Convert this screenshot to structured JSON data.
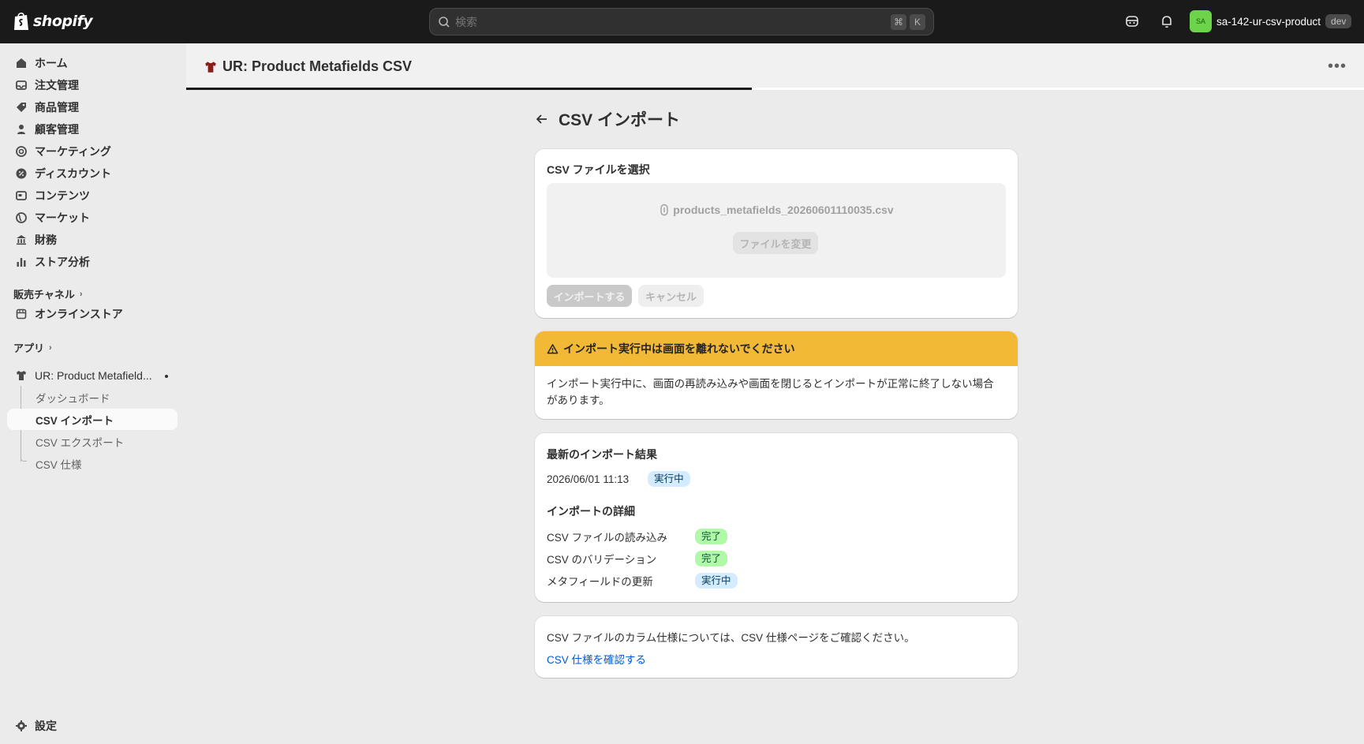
{
  "topbar": {
    "logo_text": "shopify",
    "search_placeholder": "検索",
    "shortcut_keys": [
      "⌘",
      "K"
    ],
    "store_avatar": "SA",
    "store_name": "sa-142-ur-csv-product",
    "store_badge": "dev"
  },
  "sidebar": {
    "items": [
      {
        "label": "ホーム",
        "icon": "home-icon"
      },
      {
        "label": "注文管理",
        "icon": "inbox-icon"
      },
      {
        "label": "商品管理",
        "icon": "tag-icon"
      },
      {
        "label": "顧客管理",
        "icon": "person-icon"
      },
      {
        "label": "マーケティング",
        "icon": "target-icon"
      },
      {
        "label": "ディスカウント",
        "icon": "discount-icon"
      },
      {
        "label": "コンテンツ",
        "icon": "content-icon"
      },
      {
        "label": "マーケット",
        "icon": "globe-icon"
      },
      {
        "label": "財務",
        "icon": "bank-icon"
      },
      {
        "label": "ストア分析",
        "icon": "chart-icon"
      }
    ],
    "sales_channels_label": "販売チャネル",
    "online_store_label": "オンラインストア",
    "apps_label": "アプリ",
    "app_name": "UR: Product Metafield...",
    "app_subitems": [
      "ダッシュボード",
      "CSV インポート",
      "CSV エクスポート",
      "CSV 仕様"
    ],
    "active_subitem": "CSV インポート",
    "settings_label": "設定"
  },
  "app_header": {
    "title": "UR: Product Metafields CSV",
    "loading_progress": 0.48
  },
  "page": {
    "title": "CSV インポート"
  },
  "file_card": {
    "title": "CSV ファイルを選択",
    "filename": "products_metafields_20260601110035.csv",
    "change_label": "ファイルを変更",
    "import_label": "インポートする",
    "cancel_label": "キャンセル"
  },
  "warning_card": {
    "title": "インポート実行中は画面を離れないでください",
    "body": "インポート実行中に、画面の再読み込みや画面を閉じるとインポートが正常に終了しない場合があります。"
  },
  "result_card": {
    "title": "最新のインポート結果",
    "timestamp": "2026/06/01 11:13",
    "status": "実行中",
    "details_title": "インポートの詳細",
    "steps": [
      {
        "label": "CSV ファイルの読み込み",
        "status": "完了"
      },
      {
        "label": "CSV のバリデーション",
        "status": "完了"
      },
      {
        "label": "メタフィールドの更新",
        "status": "実行中"
      }
    ]
  },
  "spec_card": {
    "text": "CSV ファイルのカラム仕様については、CSV 仕様ページをご確認ください。",
    "link": "CSV 仕様を確認する"
  },
  "colors": {
    "topbar": "#1a1a1a",
    "warning": "#f1b935",
    "link": "#005bd3",
    "badge_running": "#d5ebff",
    "badge_done": "#aff9a8",
    "avatar": "#6cd34b"
  }
}
